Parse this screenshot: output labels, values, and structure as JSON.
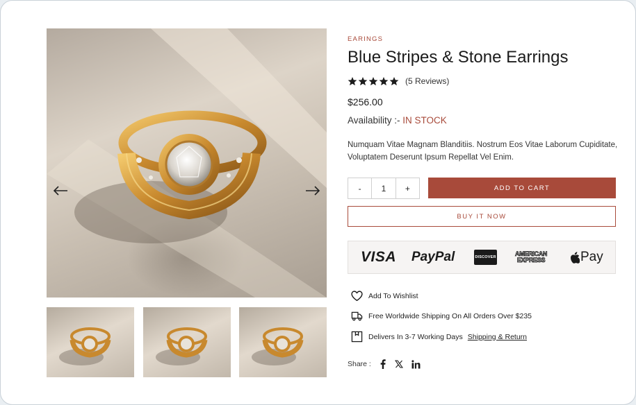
{
  "product": {
    "category": "EARINGS",
    "title": "Blue Stripes & Stone Earrings",
    "reviews": "(5 Reviews)",
    "rating": 5,
    "price": "$256.00",
    "availability_label": "Availability :-",
    "availability_status": "IN STOCK",
    "description": "Numquam Vitae Magnam Blanditiis. Nostrum Eos Vitae Laborum Cupiditate, Voluptatem Deserunt Ipsum Repellat Vel Enim."
  },
  "gallery": {
    "prev_icon": "arrow-left-icon",
    "next_icon": "arrow-right-icon",
    "thumbnail_count": 3
  },
  "purchase": {
    "qty_minus": "-",
    "qty_value": "1",
    "qty_plus": "+",
    "add_to_cart": "ADD TO CART",
    "buy_now": "BUY IT NOW"
  },
  "payments": {
    "visa": "VISA",
    "paypal": "PayPal",
    "discover": "DISCOVER",
    "amex_line1": "AMERICAN",
    "amex_line2": "EXPRESS",
    "applepay": "Pay"
  },
  "features": {
    "wishlist": "Add To Wishlist",
    "shipping": "Free Worldwide Shipping On All Orders Over $235",
    "delivery": "Delivers In 3-7 Working Days",
    "shipping_link": "Shipping & Return"
  },
  "share": {
    "label": "Share :"
  },
  "colors": {
    "accent": "#a84a3a",
    "text": "#1c1c1c",
    "payments_bg": "#f6f4f3"
  }
}
